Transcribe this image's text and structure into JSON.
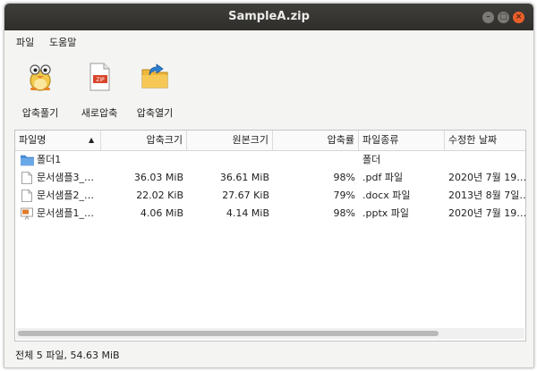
{
  "window": {
    "title": "SampleA.zip"
  },
  "menu": {
    "items": [
      "파일",
      "도움말"
    ]
  },
  "toolbar": {
    "buttons": [
      {
        "label": "압축풀기",
        "icon": "extract-icon"
      },
      {
        "label": "새로압축",
        "icon": "new-zip-icon"
      },
      {
        "label": "압축열기",
        "icon": "open-archive-icon"
      }
    ]
  },
  "list": {
    "columns": [
      "파일명",
      "압축크기",
      "원본크기",
      "압축률",
      "파일종류",
      "수정한 날짜"
    ],
    "sort_indicator": "▲",
    "rows": [
      {
        "name": "폴더1",
        "compressed": "",
        "original": "",
        "ratio": "",
        "type": "폴더",
        "date": "",
        "icon": "folder-icon"
      },
      {
        "name": "문서샘플3_…",
        "compressed": "36.03 MiB",
        "original": "36.61 MiB",
        "ratio": "98%",
        "type": ".pdf 파일",
        "date": "2020년 7월 19…",
        "icon": "pdf-file-icon"
      },
      {
        "name": "문서샘플2_…",
        "compressed": "22.02 KiB",
        "original": "27.67 KiB",
        "ratio": "79%",
        "type": ".docx 파일",
        "date": "2013년 8월 7일…",
        "icon": "docx-file-icon"
      },
      {
        "name": "문서샘플1_…",
        "compressed": "4.06 MiB",
        "original": "4.14 MiB",
        "ratio": "98%",
        "type": ".pptx 파일",
        "date": "2020년 7월 19…",
        "icon": "pptx-file-icon"
      }
    ]
  },
  "status": {
    "text": "전체 5 파일, 54.63 MiB"
  },
  "colors": {
    "titlebar": "#3c3b37",
    "close": "#e95f2a",
    "folder": "#4a90d9"
  }
}
